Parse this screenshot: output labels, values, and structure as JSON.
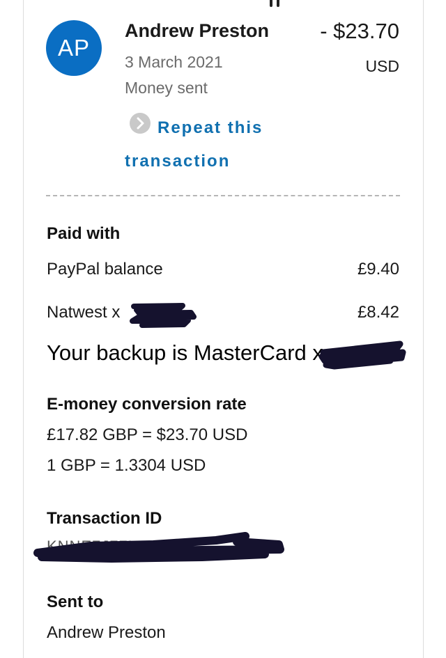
{
  "header": {
    "avatar_initials": "AP",
    "name": "Andrew Preston",
    "amount": "- $23.70",
    "currency": "USD",
    "date": "3 March 2021",
    "status": "Money sent",
    "repeat_link": "Repeat this transaction",
    "repeat_icon": "chevron-right-icon",
    "avatar_color": "#0a6ec3",
    "link_color": "#1070b0"
  },
  "paid_with": {
    "title": "Paid with",
    "items": [
      {
        "label": "PayPal balance",
        "value": "£9.40"
      },
      {
        "label": "Natwest x",
        "value": "£8.42"
      }
    ],
    "backup_text": "Your backup is MasterCard x"
  },
  "conversion": {
    "title": "E-money conversion rate",
    "line1": "£17.82 GBP = $23.70 USD",
    "line2": "1 GBP = 1.3304 USD"
  },
  "transaction": {
    "title": "Transaction ID",
    "id_visible_fragment": "KNNE7J77UE7"
  },
  "sent_to": {
    "title": "Sent to",
    "name": "Andrew Preston"
  }
}
